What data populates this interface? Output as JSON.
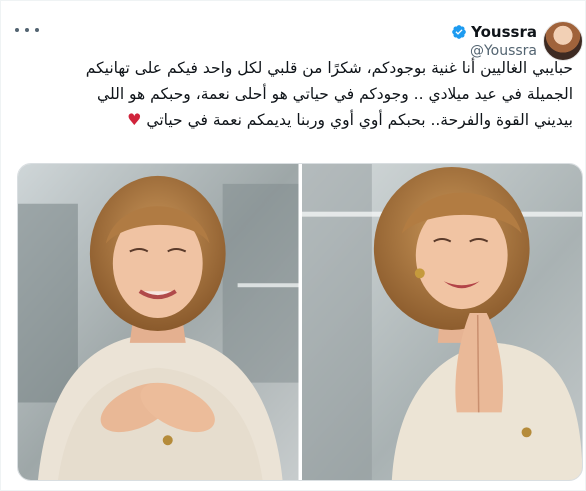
{
  "tweet": {
    "author": {
      "display_name": "Youssra",
      "handle": "@Youssra",
      "verified": true
    },
    "text_lines": [
      "حبايبي الغاليين أنا غنية بوجودكم، شكرًا من قلبي لكل واحد فيكم على تهانيكم",
      "الجميلة في عيد ميلادي .. وجودكم في حياتي هو أحلى نعمة، وحبكم هو اللي",
      "بيديني القوة والفرحة.. بحبكم أوي أوي وربنا يديمكم نعمة في حياتي"
    ],
    "emoji": "♥",
    "media": [
      {
        "icon": "photo-hands-on-chest"
      },
      {
        "icon": "photo-hands-together"
      }
    ]
  },
  "colors": {
    "accent": "#1d9bf0",
    "text": "#0f1419",
    "muted": "#536471",
    "heart": "#d0233b"
  }
}
